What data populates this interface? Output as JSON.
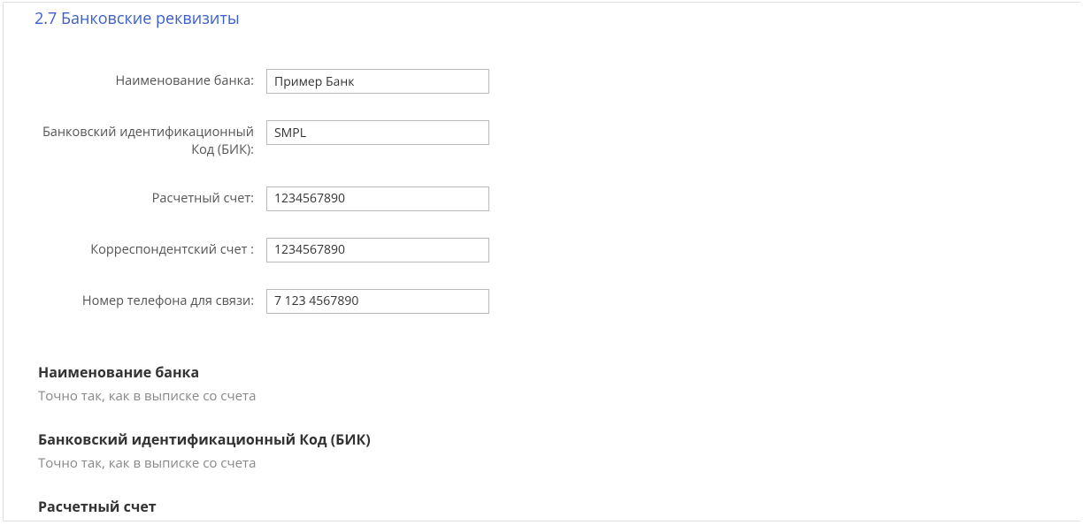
{
  "section": {
    "title": "2.7 Банковские реквизиты"
  },
  "form": {
    "bank_name": {
      "label": "Наименование банка:",
      "value": "Пример Банк"
    },
    "bik": {
      "label": "Банковский идентификационный Код (БИК):",
      "value": "SMPL"
    },
    "account": {
      "label": "Расчетный счет:",
      "value": "1234567890"
    },
    "corr": {
      "label": "Корреспондентский счет :",
      "value": "1234567890"
    },
    "phone": {
      "label": "Номер телефона для связи:",
      "value": "7 123 4567890"
    }
  },
  "help": {
    "bank_name": {
      "title": "Наименование банка",
      "desc": "Точно так, как в выписке со счета"
    },
    "bik": {
      "title": "Банковский идентификационный Код (БИК)",
      "desc": "Точно так, как в выписке со счета"
    },
    "account": {
      "title": "Расчетный счет",
      "desc": ""
    }
  }
}
